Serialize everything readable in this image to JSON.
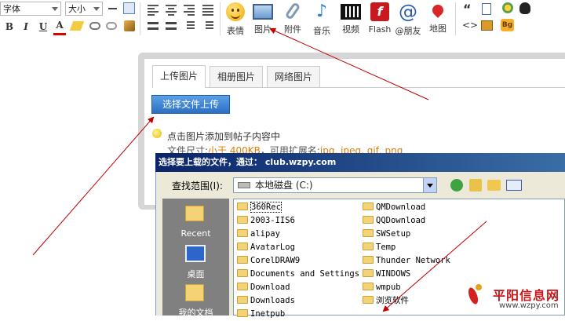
{
  "toolbar": {
    "font_select": "字体",
    "size_select": "大小",
    "format_buttons": [
      "B",
      "I",
      "U",
      "A"
    ],
    "media": [
      {
        "label": "表情",
        "icon": "smiley-icon"
      },
      {
        "label": "图片",
        "icon": "image-icon"
      },
      {
        "label": "附件",
        "icon": "paperclip-icon"
      },
      {
        "label": "音乐",
        "icon": "music-note-icon"
      },
      {
        "label": "视频",
        "icon": "film-icon"
      },
      {
        "label": "Flash",
        "icon": "flash-icon"
      },
      {
        "label": "@朋友",
        "icon": "at-icon"
      },
      {
        "label": "地图",
        "icon": "map-pin-icon"
      }
    ],
    "right_icons": [
      "quote-icon",
      "code-icon",
      "document-icon",
      "package-icon",
      "key-icon",
      "qq-icon",
      "bg-icon"
    ],
    "quote_glyph": "“",
    "code_glyph": "<>",
    "bg_badge": "Bg"
  },
  "upload": {
    "tabs": [
      "上传图片",
      "相册图片",
      "网络图片"
    ],
    "button": "选择文件上传",
    "hint": "点击图片添加到帖子内容中",
    "info_prefix": "文件尺寸:",
    "info_size": "小于 400KB",
    "info_mid": "，可用扩展名:",
    "info_ext": "jpg, jpeg, gif, png"
  },
  "dialog": {
    "title": "选择要上载的文件，通过： club.wzpy.com",
    "lookin_label": "查找范围(I):",
    "lookin_value": "本地磁盘 (C:)",
    "places": [
      "Recent",
      "桌面",
      "我的文档"
    ],
    "files_left": [
      "360Rec",
      "2003-IIS6",
      "alipay",
      "AvatarLog",
      "CorelDRAW9",
      "Documents and Settings",
      "Download",
      "Downloads",
      "Inetpub"
    ],
    "files_right": [
      "QMDownload",
      "QQDownload",
      "SWSetup",
      "Temp",
      "Thunder Network",
      "WINDOWS",
      "wmpub",
      "浏览软件"
    ]
  },
  "watermark": {
    "brand": "平阳信息网",
    "url": "www.wzpy.com"
  },
  "colors": {
    "accent_blue": "#2d6fc2",
    "annotation_red": "#c00000",
    "orange_text": "#e07b00"
  }
}
